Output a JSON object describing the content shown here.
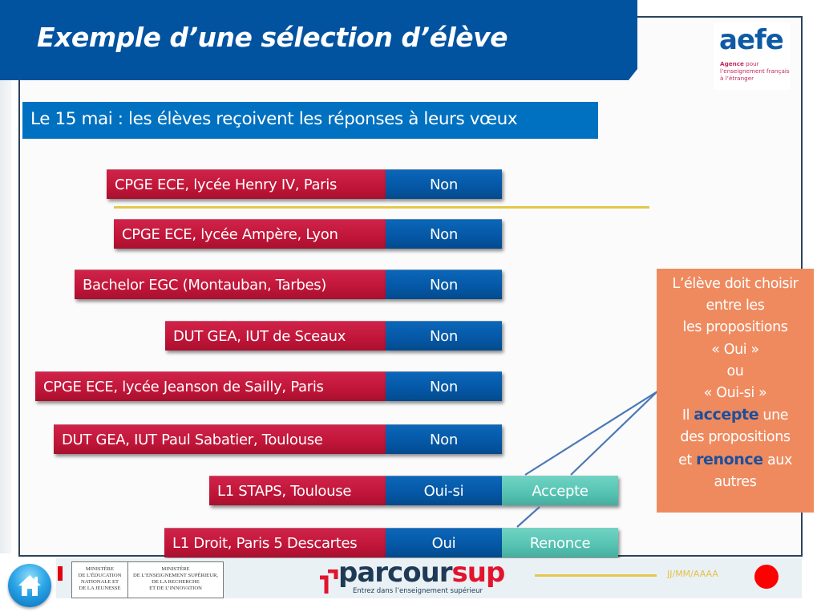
{
  "slide": {
    "title": "Exemple d’une sélection d’élève",
    "subtitle": "Le 15 mai : les élèves reçoivent les réponses à leurs vœux"
  },
  "logo": {
    "name": "aefe",
    "line1_bold": "Agence",
    "line1_rest": " pour",
    "line2": "l’enseignement français",
    "line3": "à l’étranger"
  },
  "rows": [
    {
      "formation": "CPGE ECE, lycée Henry IV, Paris",
      "response": "Non",
      "action": ""
    },
    {
      "formation": "CPGE ECE, lycée Ampère, Lyon",
      "response": "Non",
      "action": ""
    },
    {
      "formation": "Bachelor EGC (Montauban, Tarbes)",
      "response": "Non",
      "action": ""
    },
    {
      "formation": "DUT GEA, IUT de Sceaux",
      "response": "Non",
      "action": ""
    },
    {
      "formation": "CPGE ECE, lycée Jeanson de Sailly, Paris",
      "response": "Non",
      "action": ""
    },
    {
      "formation": "DUT GEA, IUT Paul Sabatier, Toulouse",
      "response": "Non",
      "action": ""
    },
    {
      "formation": "L1 STAPS, Toulouse",
      "response": "Oui-si",
      "action": "Accepte"
    },
    {
      "formation": "L1 Droit, Paris 5 Descartes",
      "response": "Oui",
      "action": "Renonce"
    }
  ],
  "callout": {
    "line1": "L’élève doit choisir",
    "line2": "entre les",
    "line3": "les propositions",
    "line4": "« Oui »",
    "line5": "ou",
    "line6": "« Oui-si »",
    "line7_pre": "Il ",
    "line7_kw": "accepte",
    "line7_post": " une",
    "line8": "des propositions",
    "line9_pre": "et ",
    "line9_kw": "renonce",
    "line9_post": " aux",
    "line10": "autres"
  },
  "footer": {
    "ministry1": [
      "MINISTÈRE",
      "DE L’ÉDUCATION",
      "NATIONALE ET",
      "DE LA JEUNESSE"
    ],
    "ministry2": [
      "MINISTÈRE",
      "DE L’ENSEIGNEMENT SUPÉRIEUR,",
      "DE LA RECHERCHE",
      "ET DE L’INNOVATION"
    ],
    "brand_main": "parcour",
    "brand_accent": "sup",
    "brand_tagline": "Entrez dans l’enseignement supérieur",
    "date": "JJ/MM/AAAA",
    "home_icon": "home-icon"
  },
  "colors": {
    "title_blue": "#0153a0",
    "subtitle_blue": "#0070c0",
    "formation_red": "#c01538",
    "response_blue": "#0457a5",
    "action_teal": "#55c2b1",
    "callout_orange": "#ef8a5f",
    "accent_yellow": "#e2c84c",
    "dot_red": "#ff0000"
  }
}
